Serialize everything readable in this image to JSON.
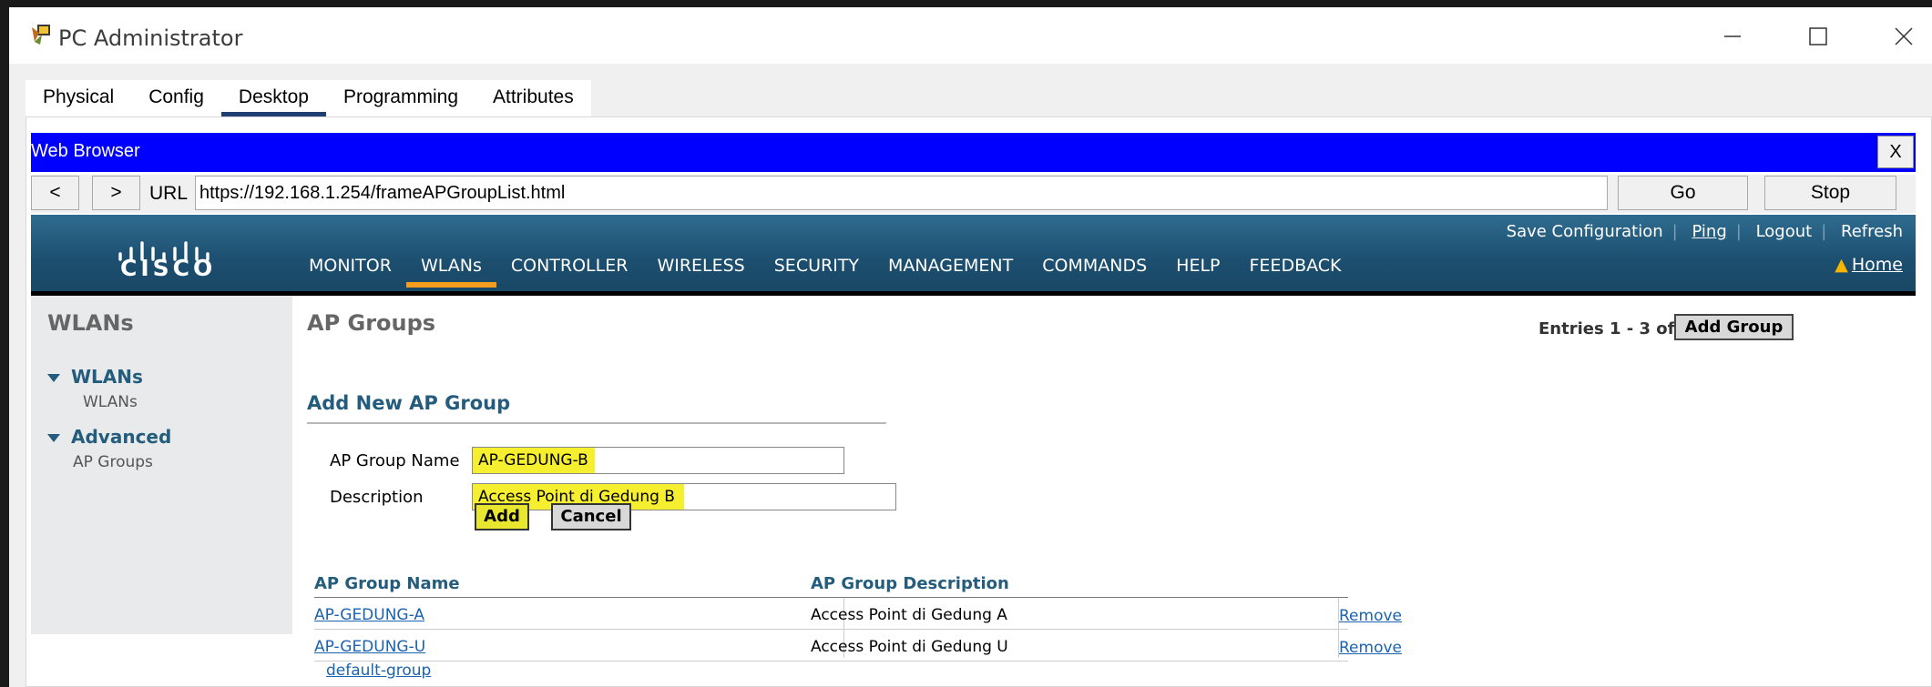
{
  "window": {
    "title": "PC Administrator"
  },
  "device_tabs": [
    "Physical",
    "Config",
    "Desktop",
    "Programming",
    "Attributes"
  ],
  "browser": {
    "title": "Web Browser",
    "close_label": "X",
    "back_label": "<",
    "forward_label": ">",
    "url_label": "URL",
    "url": "https://192.168.1.254/frameAPGroupList.html",
    "go_label": "Go",
    "stop_label": "Stop"
  },
  "cisco": {
    "brand": "CISCO",
    "top_links": [
      "Save Configuration",
      "Ping",
      "Logout",
      "Refresh"
    ],
    "menu": [
      "MONITOR",
      "WLANs",
      "CONTROLLER",
      "WIRELESS",
      "SECURITY",
      "MANAGEMENT",
      "COMMANDS",
      "HELP",
      "FEEDBACK"
    ],
    "active_menu": "WLANs",
    "home_label": "Home"
  },
  "sidebar": {
    "title": "WLANs",
    "groups": [
      {
        "heading": "WLANs",
        "items": [
          "WLANs"
        ]
      },
      {
        "heading": "Advanced",
        "items": [
          "AP Groups"
        ]
      }
    ]
  },
  "content": {
    "page_title": "AP Groups",
    "entries": "Entries 1 - 3 of 3",
    "add_group_label": "Add Group",
    "form": {
      "title": "Add New AP Group",
      "name_label": "AP Group Name",
      "name_value": "AP-GEDUNG-B",
      "description_label": "Description",
      "description_value": "Access Point di Gedung B",
      "add_label": "Add",
      "cancel_label": "Cancel"
    },
    "table": {
      "headers": [
        "AP Group Name",
        "AP Group Description"
      ],
      "rows": [
        {
          "name": "AP-GEDUNG-A",
          "description": "Access Point di Gedung A",
          "action": "Remove"
        },
        {
          "name": "AP-GEDUNG-U",
          "description": "Access Point di Gedung U",
          "action": "Remove"
        },
        {
          "name": "default-group",
          "description": "",
          "action": ""
        }
      ]
    }
  },
  "colors": {
    "browser_titlebar": "#0000ff",
    "cisco_header": "#1c4e6f",
    "active_menu_underline": "#f39d1e",
    "highlight": "#f6ef30",
    "link": "#1a63b0"
  }
}
